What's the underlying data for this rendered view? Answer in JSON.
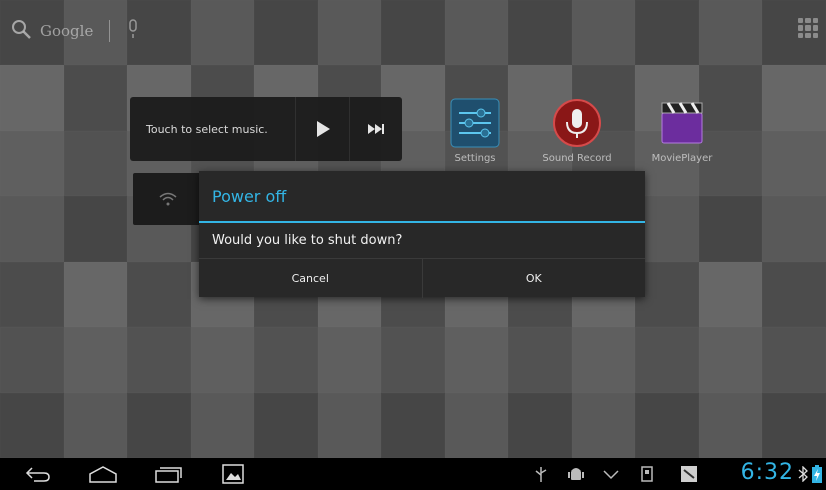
{
  "search": {
    "label": "Google"
  },
  "music_widget": {
    "text": "Touch to select music."
  },
  "apps": [
    {
      "label": "Settings"
    },
    {
      "label": "Sound Record"
    },
    {
      "label": "MoviePlayer"
    }
  ],
  "dialog": {
    "title": "Power off",
    "message": "Would you like to shut down?",
    "cancel_label": "Cancel",
    "ok_label": "OK"
  },
  "status": {
    "time": "6:32"
  },
  "colors": {
    "accent": "#33b5e5",
    "dialog_bg": "#282828",
    "nav_bg": "#000000"
  },
  "icons": [
    "search-icon",
    "mic-icon",
    "app-drawer-icon",
    "play-icon",
    "next-icon",
    "settings-icon",
    "sound-record-icon",
    "movie-player-icon",
    "wifi-icon",
    "back-icon",
    "home-icon",
    "recent-apps-icon",
    "screenshot-icon",
    "usb-icon",
    "android-debug-icon",
    "chevron-down-icon",
    "sd-card-icon",
    "notification-icon",
    "bluetooth-icon",
    "battery-icon"
  ]
}
